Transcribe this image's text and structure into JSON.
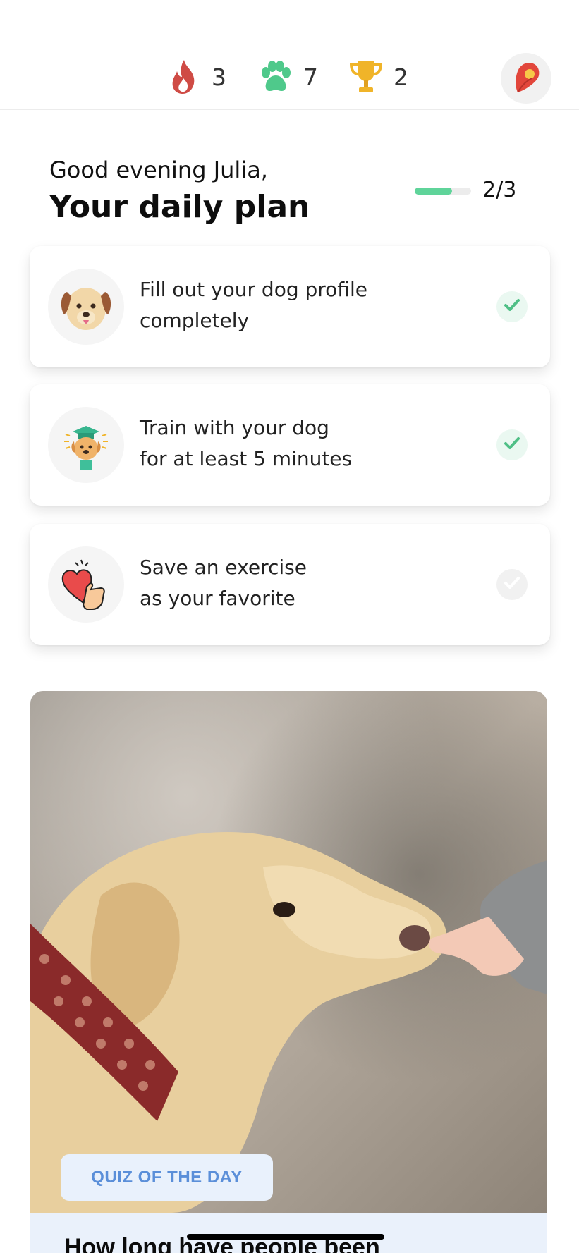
{
  "stats": {
    "streak": "3",
    "paws": "7",
    "trophies": "2"
  },
  "greeting": "Good evening Julia,",
  "plan_title": "Your daily plan",
  "progress": {
    "label": "2/3",
    "completed": 2,
    "total": 3
  },
  "tasks": [
    {
      "line1": "Fill out your dog profile",
      "line2": "completely",
      "done": true,
      "icon": "dog-face-icon"
    },
    {
      "line1": "Train with your dog",
      "line2": "for at least 5 minutes",
      "done": true,
      "icon": "graduate-dog-icon"
    },
    {
      "line1": "Save an exercise",
      "line2": "as your favorite",
      "done": false,
      "icon": "heart-hand-icon"
    }
  ],
  "quiz": {
    "badge": "QUIZ OF THE DAY",
    "question": "How long have people been"
  },
  "colors": {
    "accent_green": "#5fd49a",
    "quiz_blue": "#5b8fd9",
    "fire_red": "#d9534f",
    "paw_green": "#4fc98b",
    "trophy_gold": "#f0b429"
  }
}
